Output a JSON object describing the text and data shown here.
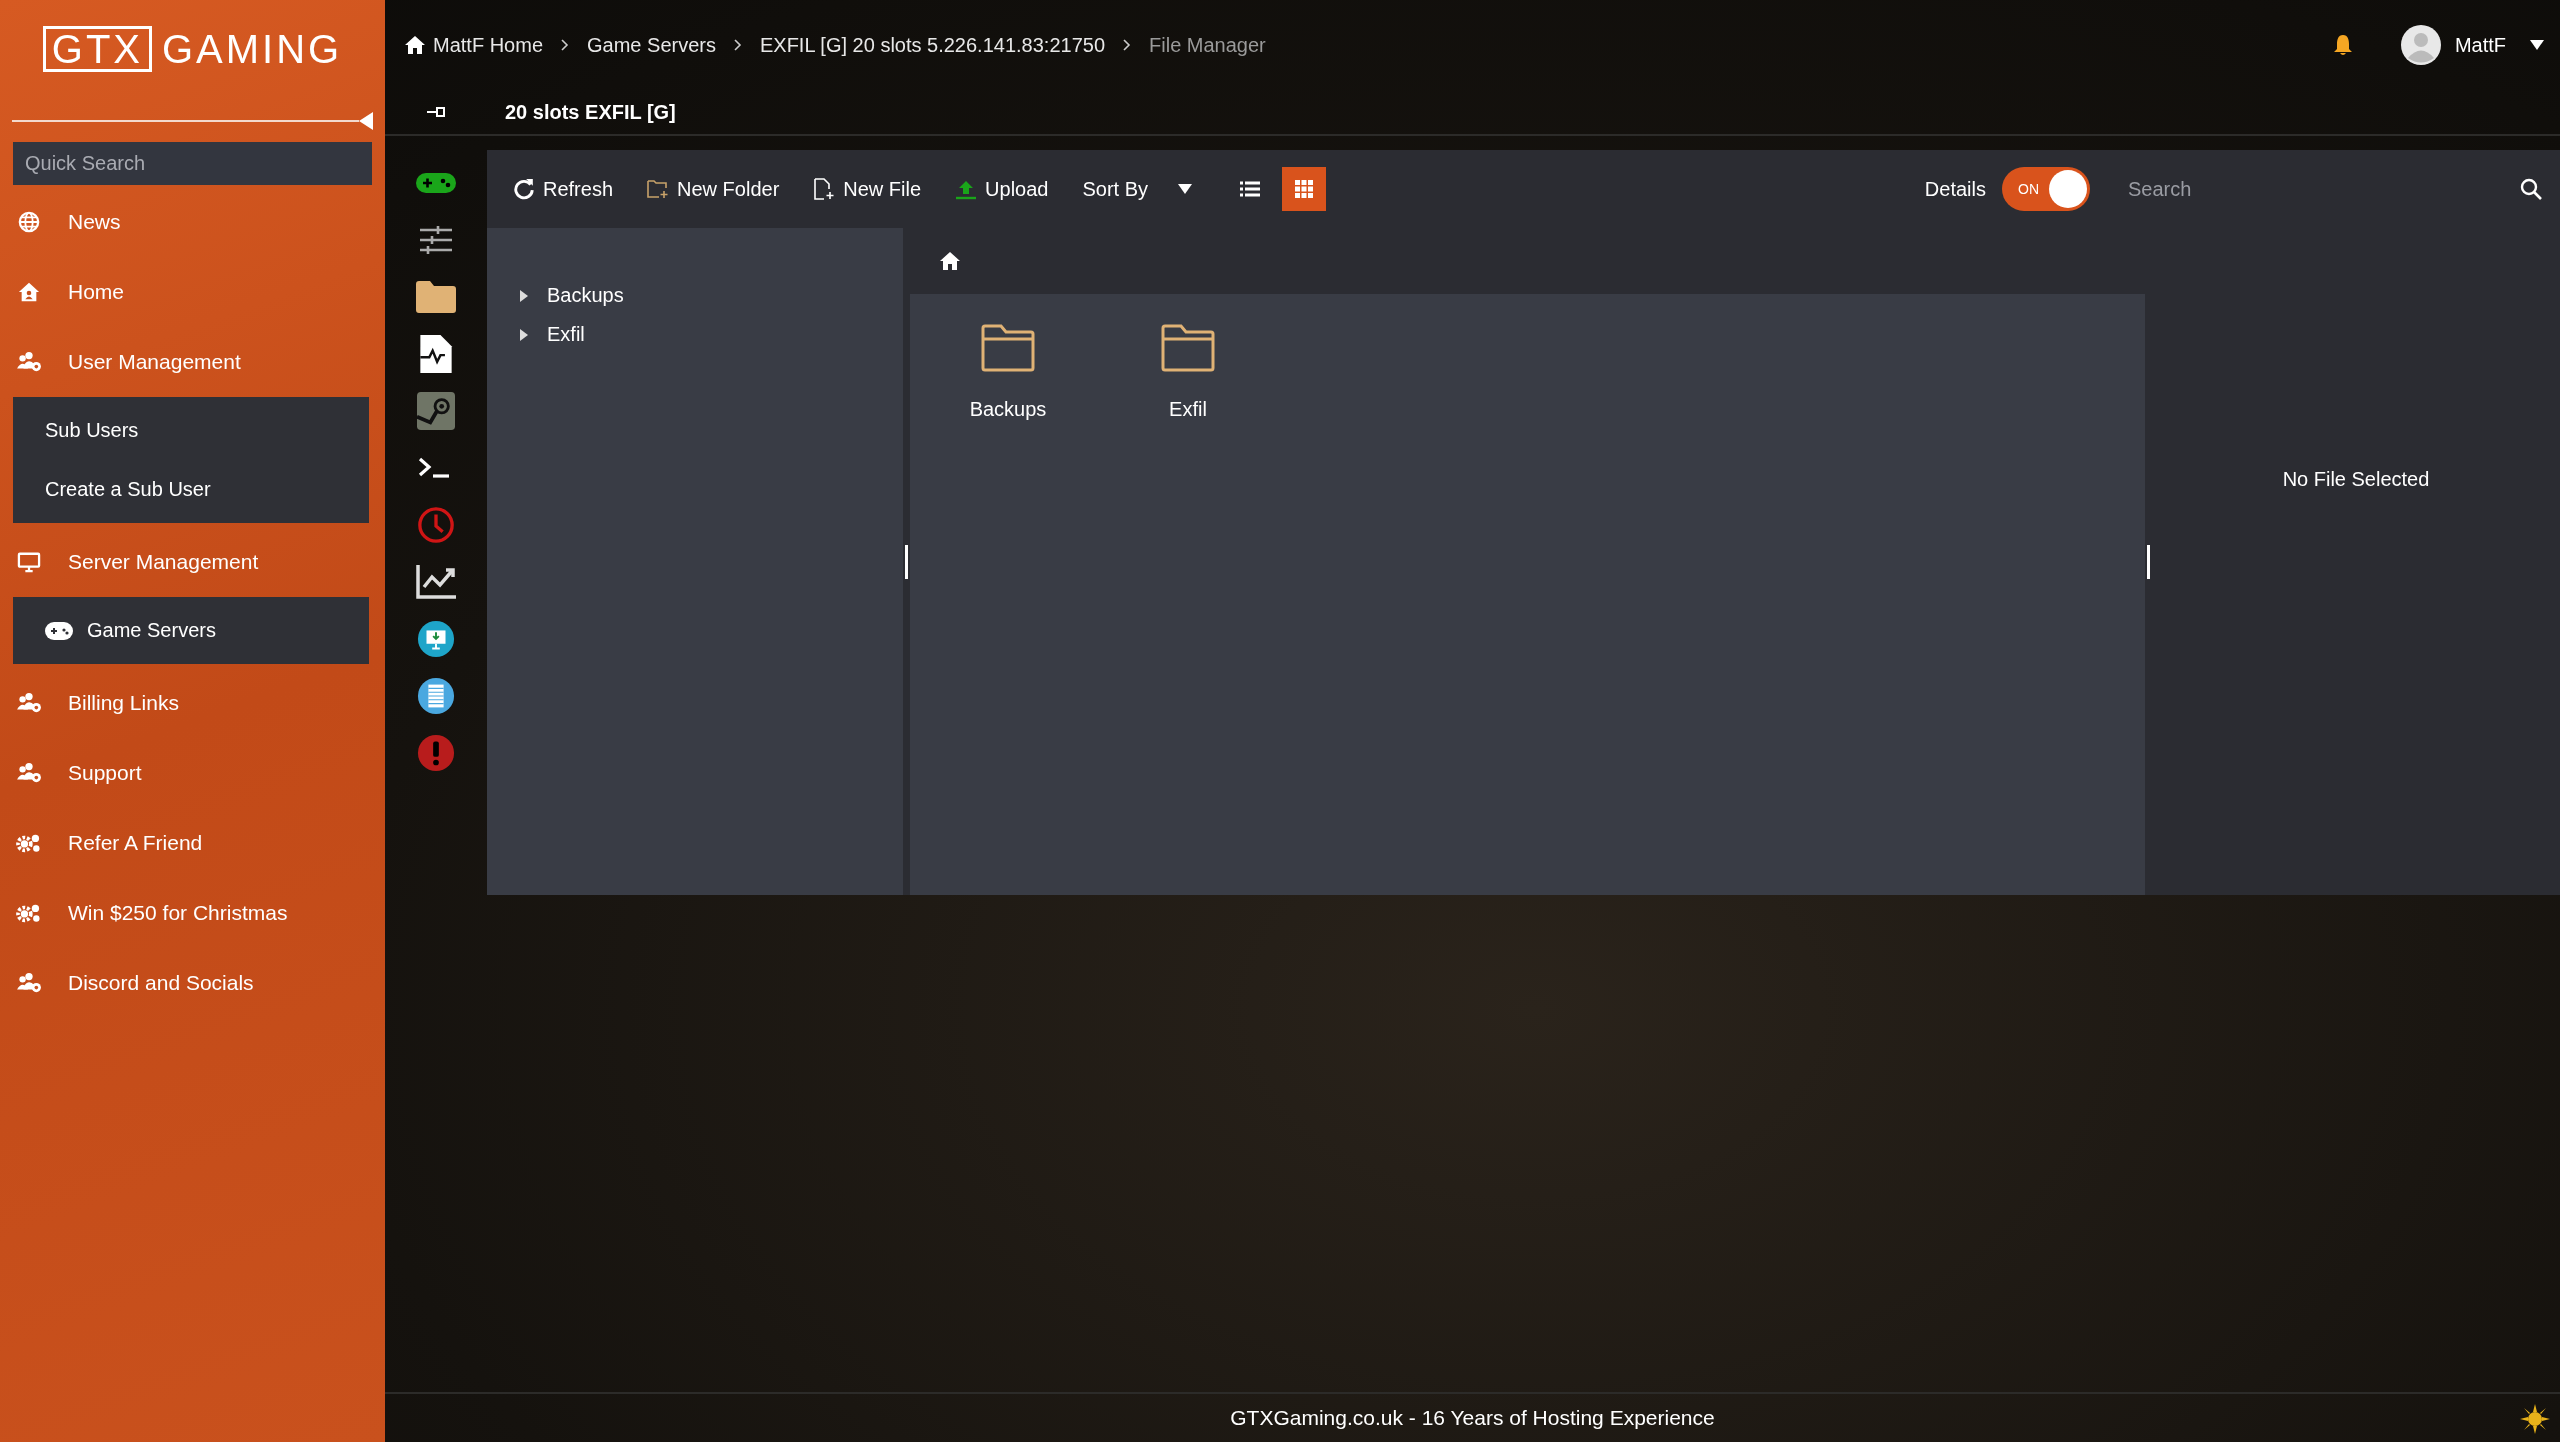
{
  "logo": {
    "boxed": "GTX",
    "rest": "GAMING"
  },
  "quick_search": {
    "placeholder": "Quick Search"
  },
  "nav": [
    {
      "label": "News"
    },
    {
      "label": "Home"
    },
    {
      "label": "User Management",
      "children": [
        {
          "label": "Sub Users"
        },
        {
          "label": "Create a Sub User"
        }
      ]
    },
    {
      "label": "Server Management",
      "children": [
        {
          "label": "Game Servers"
        }
      ]
    },
    {
      "label": "Billing Links"
    },
    {
      "label": "Support"
    },
    {
      "label": "Refer A Friend"
    },
    {
      "label": "Win $250 for Christmas"
    },
    {
      "label": "Discord and Socials"
    }
  ],
  "breadcrumb": [
    {
      "label": "MattF Home",
      "current": false
    },
    {
      "label": "Game Servers",
      "current": false
    },
    {
      "label": "EXFIL [G] 20 slots 5.226.141.83:21750",
      "current": false
    },
    {
      "label": "File Manager",
      "current": true
    }
  ],
  "user": {
    "name": "MattF"
  },
  "server_title": "20 slots EXFIL [G]",
  "toolbar": {
    "buttons": [
      "Refresh",
      "New Folder",
      "New File",
      "Upload"
    ],
    "sort_by": "Sort By",
    "views": [
      {
        "kind": "list",
        "selected": false
      },
      {
        "kind": "grid",
        "selected": true
      }
    ],
    "details": {
      "label": "Details",
      "on": true,
      "state_text": "ON"
    },
    "search": {
      "placeholder": "Search"
    }
  },
  "tree": [
    {
      "label": "Backups",
      "expanded": false
    },
    {
      "label": "Exfil",
      "expanded": false
    }
  ],
  "files": [
    {
      "name": "Backups"
    },
    {
      "name": "Exfil"
    }
  ],
  "details_pane": {
    "message": "No File Selected"
  },
  "footer": "GTXGaming.co.uk - 16 Years of Hosting Experience"
}
